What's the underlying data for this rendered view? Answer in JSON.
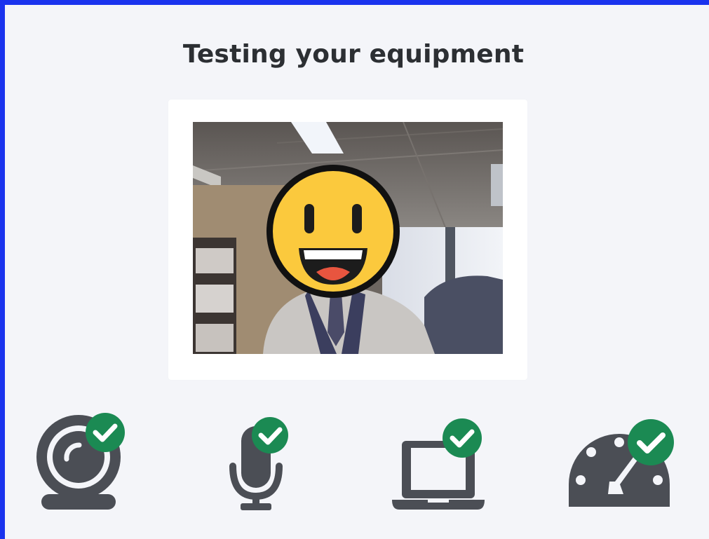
{
  "page": {
    "title": "Testing your equipment"
  },
  "colors": {
    "frame_border": "#1a33ee",
    "background": "#f4f5f9",
    "icon_gray": "#4b4e55",
    "check_green": "#1b8a53",
    "emoji_yellow": "#fbc93d"
  },
  "devices": [
    {
      "name": "webcam",
      "icon": "webcam-icon",
      "status": "passed"
    },
    {
      "name": "microphone",
      "icon": "microphone-icon",
      "status": "passed"
    },
    {
      "name": "computer",
      "icon": "laptop-icon",
      "status": "passed"
    },
    {
      "name": "connection-speed",
      "icon": "speedometer-icon",
      "status": "passed"
    }
  ],
  "video_preview": {
    "overlay": "grinning-face-emoji"
  }
}
